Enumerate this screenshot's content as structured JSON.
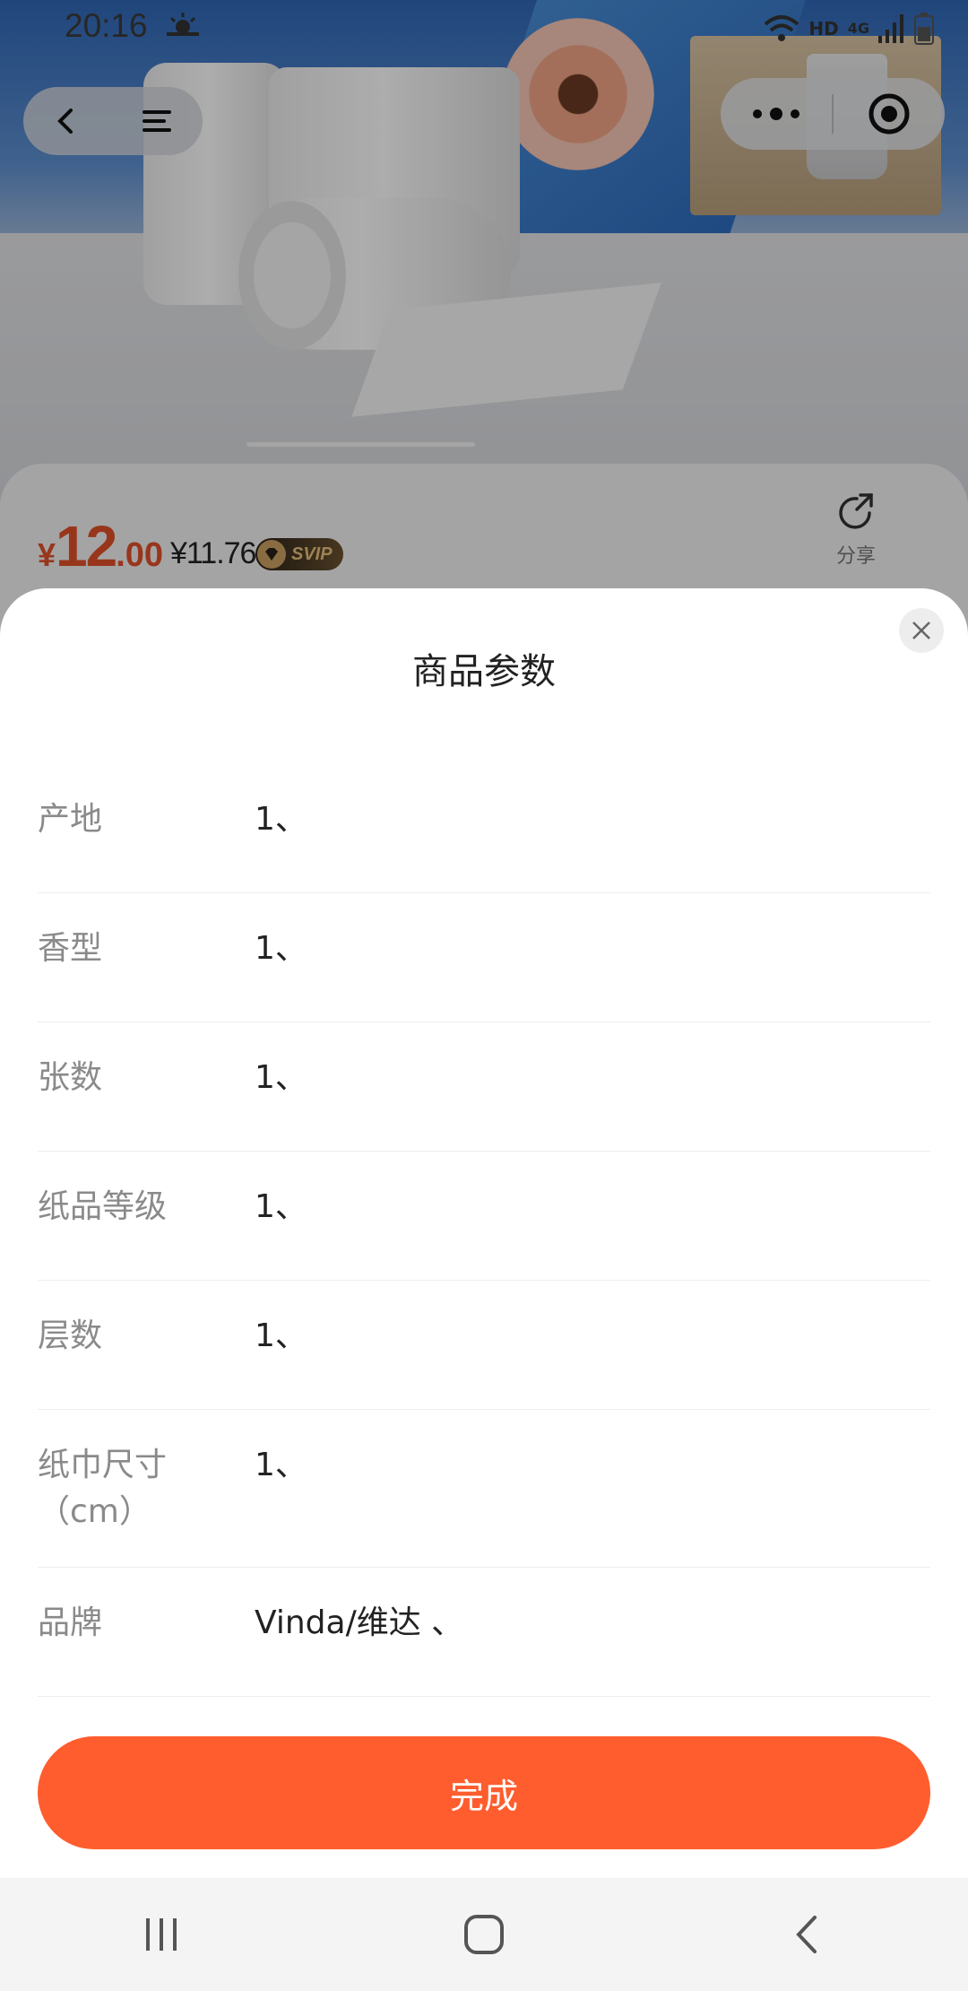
{
  "status_bar": {
    "time": "20:16",
    "hd": "HD",
    "network": "4G"
  },
  "price": {
    "currency": "¥",
    "integer": "12",
    "decimal": ".00",
    "svip_price": "¥11.76",
    "svip_badge": "SVIP"
  },
  "share": {
    "label": "分享"
  },
  "sheet": {
    "title": "商品参数",
    "params": [
      {
        "label": "产地",
        "value": "1、"
      },
      {
        "label": "香型",
        "value": "1、"
      },
      {
        "label": "张数",
        "value": "1、"
      },
      {
        "label": "纸品等级",
        "value": "1、"
      },
      {
        "label": "层数",
        "value": "1、"
      },
      {
        "label": "纸巾尺寸（cm）",
        "value": "1、"
      },
      {
        "label": "品牌",
        "value": "Vinda/维达 、"
      }
    ],
    "done_label": "完成"
  },
  "colors": {
    "accent": "#ff5d2e",
    "price": "#e0502a"
  }
}
